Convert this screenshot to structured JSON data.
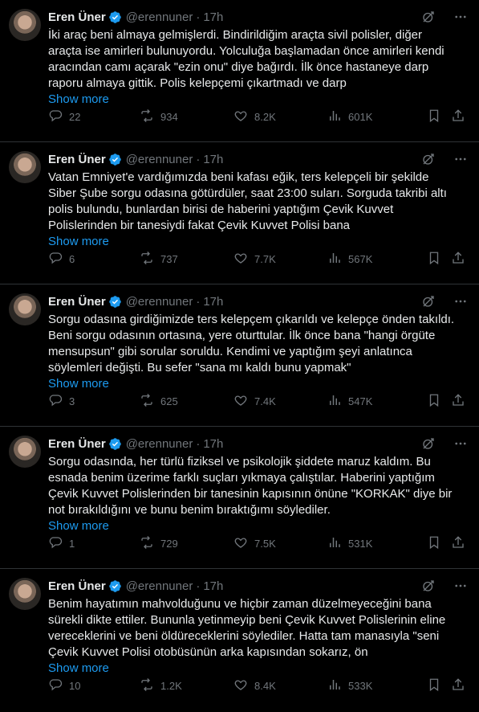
{
  "author": {
    "name": "Eren Üner",
    "handle": "@erennuner"
  },
  "show_more_label": "Show more",
  "tweets": [
    {
      "time": "17h",
      "lines": [
        "İki araç beni almaya gelmişlerdi. Bindirildiğim araçta sivil polisler, diğer",
        "araçta ise amirleri bulunuyordu. Yolculuğa başlamadan önce amirleri kendi",
        "aracından camı açarak \"ezin onu\" diye bağırdı. İlk önce hastaneye darp",
        "raporu almaya gittik. Polis kelepçemi çıkartmadı ve darp"
      ],
      "replies": "22",
      "reposts": "934",
      "likes": "8.2K",
      "views": "601K"
    },
    {
      "time": "17h",
      "lines": [
        "Vatan Emniyet'e vardığımızda beni kafası eğik, ters kelepçeli bir şekilde",
        "Siber Şube sorgu odasına götürdüler, saat 23:00 suları. Sorguda takribi altı",
        "polis bulundu, bunlardan birisi de haberini yaptığım Çevik Kuvvet",
        "Polislerinden bir tanesiydi fakat Çevik Kuvvet Polisi bana"
      ],
      "replies": "6",
      "reposts": "737",
      "likes": "7.7K",
      "views": "567K"
    },
    {
      "time": "17h",
      "lines": [
        "Sorgu odasına girdiğimizde ters kelepçem çıkarıldı ve kelepçe önden takıldı.",
        "Beni sorgu odasının ortasına, yere oturttular. İlk önce bana \"hangi örgüte",
        "mensupsun\" gibi sorular soruldu. Kendimi ve yaptığım şeyi anlatınca",
        "söylemleri değişti. Bu sefer \"sana mı kaldı bunu yapmak\""
      ],
      "replies": "3",
      "reposts": "625",
      "likes": "7.4K",
      "views": "547K"
    },
    {
      "time": "17h",
      "lines": [
        "Sorgu odasında, her türlü fiziksel ve psikolojik şiddete maruz kaldım. Bu",
        "esnada benim üzerime farklı suçları yıkmaya çalıştılar. Haberini yaptığım",
        "Çevik Kuvvet Polislerinden bir tanesinin kapısının önüne \"KORKAK\" diye bir",
        "not bırakıldığını ve bunu benim bıraktığımı söylediler."
      ],
      "replies": "1",
      "reposts": "729",
      "likes": "7.5K",
      "views": "531K"
    },
    {
      "time": "17h",
      "lines": [
        "Benim hayatımın mahvolduğunu ve hiçbir zaman düzelmeyeceğini bana",
        "sürekli dikte ettiler. Bununla yetinmeyip beni Çevik Kuvvet Polislerinin eline",
        "vereceklerini ve beni öldüreceklerini söylediler. Hatta tam manasıyla \"seni",
        "Çevik Kuvvet Polisi otobüsünün arka kapısından sokarız, ön"
      ],
      "replies": "10",
      "reposts": "1.2K",
      "likes": "8.4K",
      "views": "533K"
    }
  ]
}
